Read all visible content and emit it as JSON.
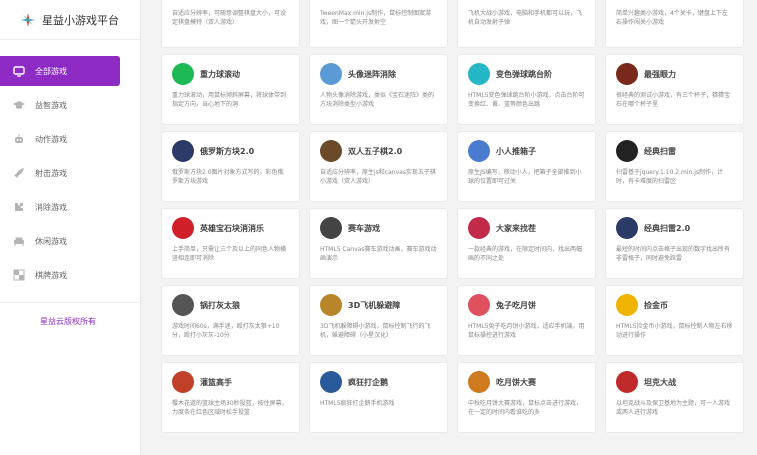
{
  "app": {
    "title": "星益小游戏平台",
    "brand_color": "#8d2bc4"
  },
  "sidebar": {
    "items": [
      {
        "label": "全部游戏",
        "icon": "tv-icon",
        "active": true
      },
      {
        "label": "益智游戏",
        "icon": "graduation-cap-icon",
        "active": false
      },
      {
        "label": "动作游戏",
        "icon": "robot-icon",
        "active": false
      },
      {
        "label": "射击游戏",
        "icon": "rocket-icon",
        "active": false
      },
      {
        "label": "消除游戏",
        "icon": "puzzle-icon",
        "active": false
      },
      {
        "label": "休闲游戏",
        "icon": "couch-icon",
        "active": false
      },
      {
        "label": "棋牌游戏",
        "icon": "chess-board-icon",
        "active": false
      }
    ],
    "copyright": "星益云版权所有"
  },
  "games_top": [
    {
      "desc": "自适应分辨率，可随意调整棋盘大小，可设定棋盘模特（双人游戏）"
    },
    {
      "desc": "TweenMax.min.js制作，鼠标控制图案游戏，图一个箭头开发射空"
    },
    {
      "desc": "飞机大战小游戏，电脑和手机都可以玩，飞机自动发射子弹"
    },
    {
      "desc": "简单兴趣类小游戏，4个关卡，键盘上下左右操作闯关小游戏"
    }
  ],
  "games": [
    {
      "title": "重力球滚动",
      "desc": "重力球滚动，用鼠标倾斜屏幕，将球体带到指定方向，当心地下的洞",
      "icon": "ball-icon",
      "color": "#1db954"
    },
    {
      "title": "头像迷阵消除",
      "desc": "人物头像消除游戏，类似《宝石迷阵》类的方块消除类型小游戏",
      "icon": "question-icon",
      "color": "#5b9bd5"
    },
    {
      "title": "变色弹球跳台阶",
      "desc": "HTML5变色弹球跳台阶小游戏，点击台阶可变换红、黄、蓝等颜色出跳",
      "icon": "dot-icon",
      "color": "#26b7c7"
    },
    {
      "title": "最强眼力",
      "desc": "很经典的测试小游戏，有三个杯子，猜猜宝石在哪个杯子里",
      "icon": "cup-icon",
      "color": "#7a2a1a"
    },
    {
      "title": "俄罗斯方块2.0",
      "desc": "俄罗斯方块2.0图片对象方式写的，彩色俄罗斯方块游戏",
      "icon": "tetris-icon",
      "color": "#2b3a67"
    },
    {
      "title": "双人五子棋2.0",
      "desc": "自适应分辨率，原生js和canvas实现五子棋小游戏（双人游戏）",
      "icon": "gobang-icon",
      "color": "#6b4a2a"
    },
    {
      "title": "小人推箱子",
      "desc": "原生JS编写，移动小人，把箱子全部推到小球的位置即可过关",
      "icon": "box-icon",
      "color": "#4a7bd0"
    },
    {
      "title": "经典扫雷",
      "desc": "扫雷基于jquery.1.10.2.min.js制作，计时，有卡难度的扫雷区",
      "icon": "mine-icon",
      "color": "#222222"
    },
    {
      "title": "英雄宝石块消消乐",
      "desc": "上手简单，只需让三个及以上的同色人物横竖相连即可消除",
      "icon": "shield-icon",
      "color": "#d0202a"
    },
    {
      "title": "赛车游戏",
      "desc": "HTML5 Canvas赛车游戏动画，赛车游戏动画演示",
      "icon": "car-icon",
      "color": "#444444"
    },
    {
      "title": "大家来找茬",
      "desc": "一款经典的游戏，在限定时间内，找出两幅画的不同之处",
      "icon": "face-icon",
      "color": "#c22a4a"
    },
    {
      "title": "经典扫雷2.0",
      "desc": "最短的时间内点击格子出现的数字找出所有非雷格子，同时避免踩雷",
      "icon": "grid-icon",
      "color": "#2b3a67"
    },
    {
      "title": "锅打灰太狼",
      "desc": "游戏时间60s，满手迷，殴打灰太狼+10分，殴打小灰灰-10分",
      "icon": "wolf-icon",
      "color": "#555555"
    },
    {
      "title": "3D飞机躲避障",
      "desc": "3D飞机躲障碍小游戏，鼠标控制飞行的飞机，躲避障碍（小星汉化）",
      "icon": "plane-icon",
      "color": "#b8862a"
    },
    {
      "title": "兔子吃月饼",
      "desc": "HTML5兔子吃月饼小游戏，适应手机端，用鼠标操控进行游戏",
      "icon": "rabbit-icon",
      "color": "#e05060"
    },
    {
      "title": "捡金币",
      "desc": "HTML5捡金币小游戏，鼠标控制人物左右移动进行操作",
      "icon": "coin-icon",
      "color": "#f0b400"
    },
    {
      "title": "灌篮高手",
      "desc": "樱木花道的篮球主场30秒投篮，按住屏幕，力度条在红色区域时松手投篮",
      "icon": "basketball-icon",
      "color": "#c0402a"
    },
    {
      "title": "疯狂打企鹅",
      "desc": "HTML5疯狂打企鹅手机游戏",
      "icon": "penguin-icon",
      "color": "#2a5a9a"
    },
    {
      "title": "吃月饼大赛",
      "desc": "中秋吃月饼大赛游戏，鼠标点击进行游戏，在一定的时间内看谁吃的多",
      "icon": "mooncake-icon",
      "color": "#d07a20"
    },
    {
      "title": "坦克大战",
      "desc": "以坦克战斗及保卫基地为主题，可一人游戏或两人进行游戏",
      "icon": "tank-icon",
      "color": "#c02a2a"
    }
  ]
}
